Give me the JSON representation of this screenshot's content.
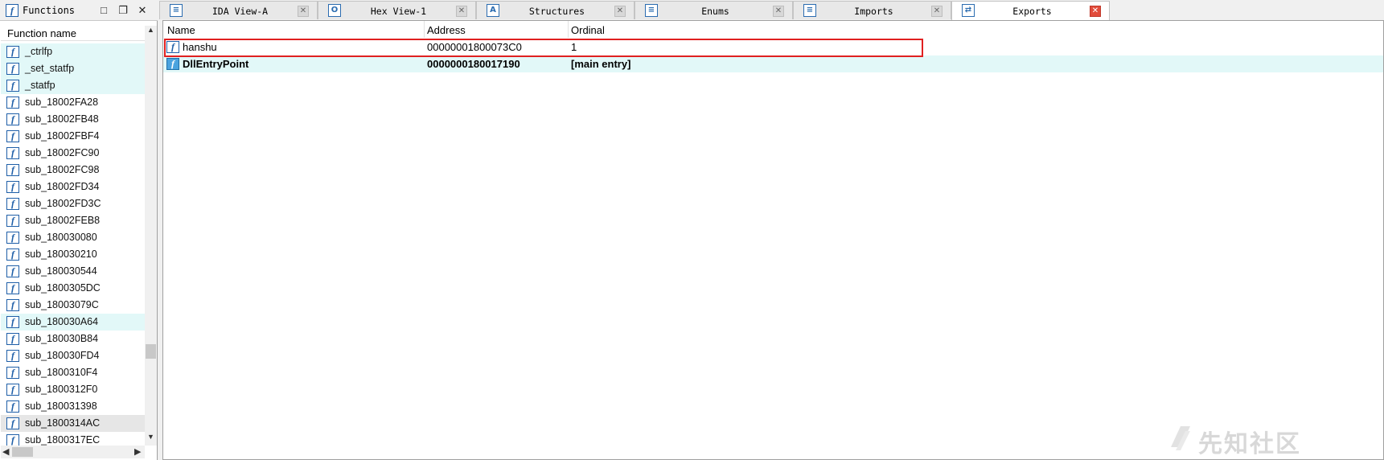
{
  "functions_panel": {
    "title": "Functions",
    "column_header": "Function name",
    "items": [
      {
        "name": "_ctrlfp",
        "state": "hl"
      },
      {
        "name": "_set_statfp",
        "state": "hl"
      },
      {
        "name": "_statfp",
        "state": "hl"
      },
      {
        "name": "sub_18002FA28",
        "state": ""
      },
      {
        "name": "sub_18002FB48",
        "state": ""
      },
      {
        "name": "sub_18002FBF4",
        "state": ""
      },
      {
        "name": "sub_18002FC90",
        "state": ""
      },
      {
        "name": "sub_18002FC98",
        "state": ""
      },
      {
        "name": "sub_18002FD34",
        "state": ""
      },
      {
        "name": "sub_18002FD3C",
        "state": ""
      },
      {
        "name": "sub_18002FEB8",
        "state": ""
      },
      {
        "name": "sub_180030080",
        "state": ""
      },
      {
        "name": "sub_180030210",
        "state": ""
      },
      {
        "name": "sub_180030544",
        "state": ""
      },
      {
        "name": "sub_1800305DC",
        "state": ""
      },
      {
        "name": "sub_18003079C",
        "state": ""
      },
      {
        "name": "sub_180030A64",
        "state": "hl"
      },
      {
        "name": "sub_180030B84",
        "state": ""
      },
      {
        "name": "sub_180030FD4",
        "state": ""
      },
      {
        "name": "sub_1800310F4",
        "state": ""
      },
      {
        "name": "sub_1800312F0",
        "state": ""
      },
      {
        "name": "sub_180031398",
        "state": ""
      },
      {
        "name": "sub_1800314AC",
        "state": "sel"
      },
      {
        "name": "sub_1800317EC",
        "state": ""
      }
    ]
  },
  "tabs": [
    {
      "label": "IDA View-A",
      "icon": "ida-view-icon",
      "glyph": "≡"
    },
    {
      "label": "Hex View-1",
      "icon": "hex-view-icon",
      "glyph": "O"
    },
    {
      "label": "Structures",
      "icon": "structures-icon",
      "glyph": "A"
    },
    {
      "label": "Enums",
      "icon": "enums-icon",
      "glyph": "≡"
    },
    {
      "label": "Imports",
      "icon": "imports-icon",
      "glyph": "≡"
    },
    {
      "label": "Exports",
      "icon": "exports-icon",
      "glyph": "⇄",
      "active": true
    }
  ],
  "exports": {
    "columns": [
      "Name",
      "Address",
      "Ordinal"
    ],
    "rows": [
      {
        "name": "hanshu",
        "address": "00000001800073C0",
        "ordinal": "1",
        "bold": false,
        "highlighted": true
      },
      {
        "name": "DllEntryPoint",
        "address": "0000000180017190",
        "ordinal": "[main entry]",
        "bold": true,
        "highlighted": false
      }
    ]
  },
  "colors": {
    "highlight_row": "#e2f8f8",
    "selection_box": "#e02020",
    "active_tab_close": "#e24c3b",
    "icon_blue": "#1f5fa8"
  },
  "watermark": "先知社区"
}
